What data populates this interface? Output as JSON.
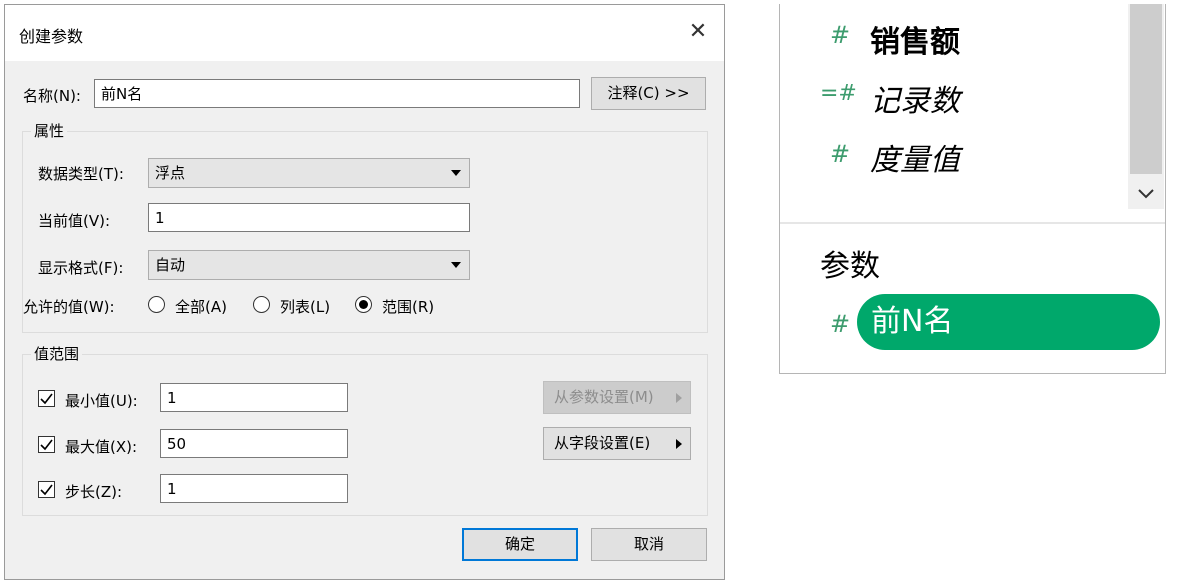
{
  "dialog": {
    "title": "创建参数",
    "name_label": "名称(N):",
    "name_value": "前N名",
    "comment_button": "注释(C) >>",
    "properties": {
      "title": "属性",
      "data_type_label": "数据类型(T):",
      "data_type_value": "浮点",
      "current_value_label": "当前值(V):",
      "current_value": "1",
      "display_format_label": "显示格式(F):",
      "display_format_value": "自动",
      "allowed_values_label": "允许的值(W):",
      "options": [
        "全部(A)",
        "列表(L)",
        "范围(R)"
      ],
      "selected_option": "范围(R)"
    },
    "range": {
      "title": "值范围",
      "min_label": "最小值(U):",
      "min_value": "1",
      "max_label": "最大值(X):",
      "max_value": "50",
      "step_label": "步长(Z):",
      "step_value": "1",
      "from_param_button": "从参数设置(M)",
      "from_field_button": "从字段设置(E)"
    },
    "ok_button": "确定",
    "cancel_button": "取消"
  },
  "panel": {
    "fields": [
      {
        "label": "销售额",
        "icon": "hash-icon"
      },
      {
        "label": "记录数",
        "icon": "hash-derived-icon"
      },
      {
        "label": "度量值",
        "icon": "hash-icon"
      }
    ],
    "section_title": "参数",
    "parameter": {
      "label": "前N名",
      "icon": "hash-icon"
    },
    "accent_color": "#00a86b"
  }
}
